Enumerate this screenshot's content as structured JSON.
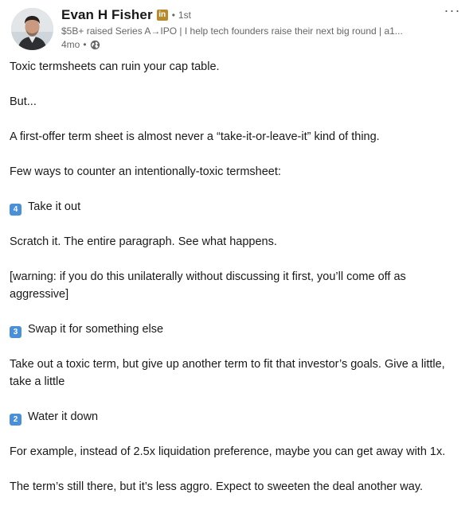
{
  "author": {
    "name": "Evan H Fisher",
    "badge_icon": "linkedin-premium-icon",
    "badge_text": "in",
    "degree": "1st",
    "headline": "$5B+ raised Series A→IPO | I help tech founders raise their next big round | a1...",
    "time": "4mo",
    "visibility_icon": "globe-icon"
  },
  "more_label": "···",
  "post": {
    "p1": "Toxic termsheets can ruin your cap table.",
    "p2": "But...",
    "p3": "A first-offer term sheet is almost never a “take-it-or-leave-it” kind of thing.",
    "p4": "Few ways to counter an intentionally-toxic termsheet:",
    "item1_num": "4",
    "item1_text": "Take it out",
    "p5": "Scratch it. The entire paragraph. See what happens.",
    "p6": "[warning: if you do this unilaterally without discussing it first, you’ll come off as aggressive]",
    "item2_num": "3",
    "item2_text": "Swap it for something else",
    "p7": "Take out a toxic term, but give up another term to fit that investor’s goals. Give a little, take a little",
    "item3_num": "2",
    "item3_text": "Water it down",
    "p8": "For example, instead of 2.5x liquidation preference, maybe you can get away with 1x.",
    "p9": "The term’s still there, but it’s less aggro. Expect to sweeten the deal another way."
  },
  "colors": {
    "text": "#191919",
    "muted": "#666666",
    "keycap": "#4a90d9",
    "badge": "#b88a2c"
  }
}
